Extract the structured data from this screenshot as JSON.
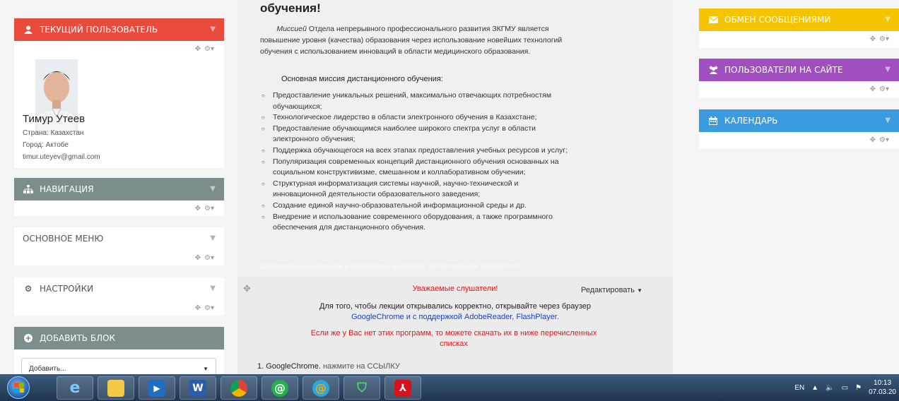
{
  "left": {
    "current_user": {
      "title": "ТЕКУЩИЙ ПОЛЬЗОВАТЕЛЬ",
      "name": "Тимур Утеев",
      "country": "Страна: Казахстан",
      "city": "Город: Актобе",
      "email": "timur.uteyev@gmail.com"
    },
    "navigation": {
      "title": "НАВИГАЦИЯ"
    },
    "main_menu": {
      "title": "ОСНОВНОЕ МЕНЮ"
    },
    "settings": {
      "title": "НАСТРОЙКИ"
    },
    "add_block": {
      "title": "ДОБАВИТЬ БЛОК",
      "select_value": "Добавить..."
    }
  },
  "center": {
    "mission": {
      "title": "обучения!",
      "para_em": "Миссией",
      "para_text": " Отдела непрерывного профессионального развития ЗКГМУ является повышение уровня (качества) образования через использование новейших технологий обучения с использованием инноваций в области медицинского образования.",
      "subtitle": "Основная миссия дистанционного обучения:",
      "items": [
        "Предоставление уникальных решений, максимально отвечающих потребностям обучающихся;",
        "Технологическое лидерство в области электронного обучения в Казахстане;",
        "Предоставление обучающимся наиболее широкого спектра услуг в области электронного обучения;",
        "Поддержка обучающегося на всех этапах предоставления учебных ресурсов и услуг;",
        "Популяризация современных концепций дистанционного обучения основанных на социальном конструктивизме, смешанном и коллаборативном обучении;",
        "Структурная информатизация системы научной, научно-технической и инновационной деятельности образовательного заведения;",
        "Создание единой научно-образовательной информационной среды и др.",
        "Внедрение и использование современного оборудования, а также программного обеспечения для дистанционного обучения."
      ],
      "tags": "дистанционное обучение в Казахстане, медицина, дистанционное образование"
    },
    "notice": {
      "edit_label": "Редактировать",
      "heading": "Уважаемые слушатели!",
      "text": "Для того, чтобы лекции открывались корректно, открывайте через браузер",
      "link": "GoogleChrome и с поддержкой AdobeReader, FlashPlayer.",
      "warning": "Если же у Вас нет этих программ, то можете скачать их в ниже перечисленных списках",
      "item1_label": "1. GoogleChrome.",
      "item1_hint": " нажмите на ССЫЛКУ"
    }
  },
  "right": {
    "messages": {
      "title": "ОБМЕН СООБЩЕНИЯМИ"
    },
    "online_users": {
      "title": "ПОЛЬЗОВАТЕЛИ НА САЙТЕ"
    },
    "calendar": {
      "title": "КАЛЕНДАРЬ"
    }
  },
  "taskbar": {
    "word_label": "W",
    "lang": "EN",
    "time": "10:13",
    "date": "07.03.20"
  },
  "colors": {
    "red": "#e84b3c",
    "gray": "#7d8c8c",
    "yellow": "#f5c400",
    "purple": "#a14fc0",
    "blue": "#3a9be0"
  }
}
